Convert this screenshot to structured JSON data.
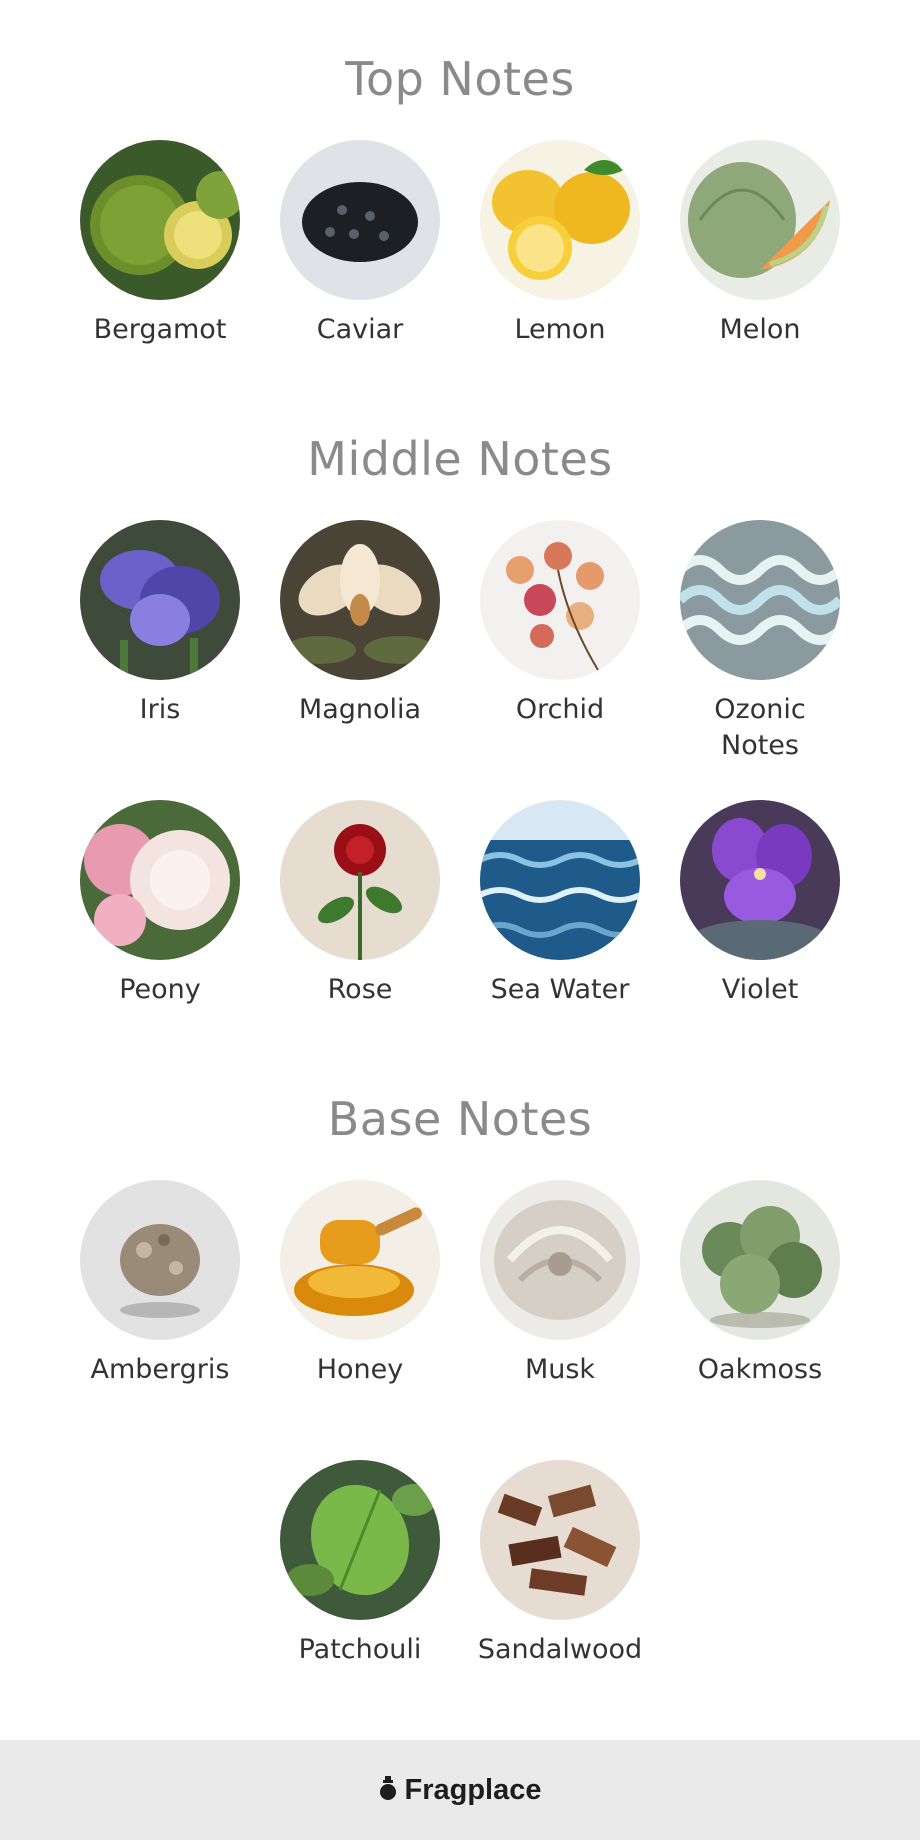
{
  "sections": {
    "top": {
      "title": "Top Notes",
      "items": [
        "Bergamot",
        "Caviar",
        "Lemon",
        "Melon"
      ]
    },
    "middle": {
      "title": "Middle Notes",
      "items": [
        "Iris",
        "Magnolia",
        "Orchid",
        "Ozonic Notes",
        "Peony",
        "Rose",
        "Sea Water",
        "Violet"
      ]
    },
    "base": {
      "title": "Base Notes",
      "items": [
        "Ambergris",
        "Honey",
        "Musk",
        "Oakmoss",
        "Patchouli",
        "Sandalwood"
      ]
    }
  },
  "footer": {
    "brand": "Fragplace",
    "logo_icon": "perfume-bottle-icon"
  }
}
